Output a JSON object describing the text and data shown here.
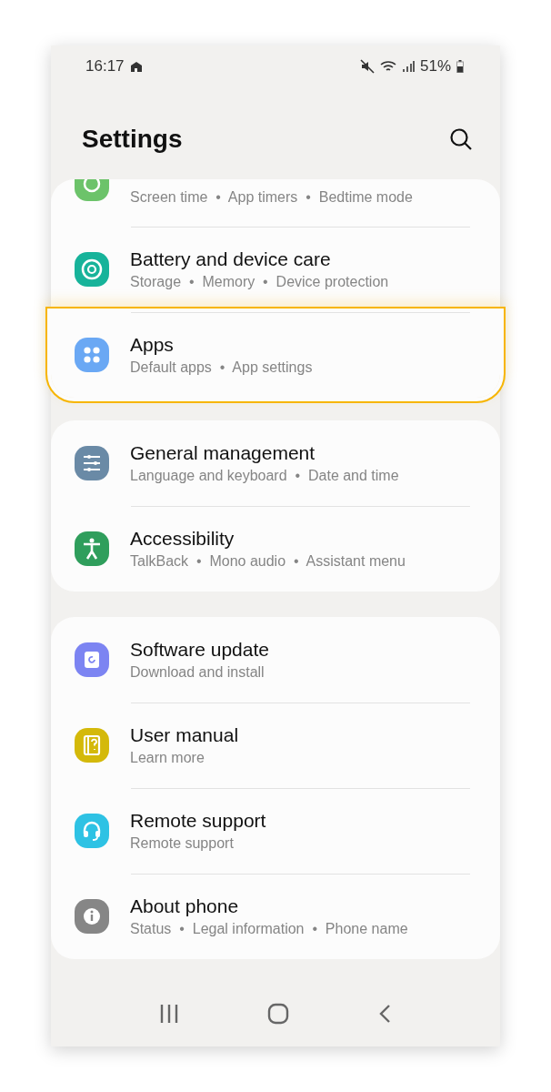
{
  "status_bar": {
    "time": "16:17",
    "battery": "51%"
  },
  "header": {
    "title": "Settings"
  },
  "groups": [
    {
      "items": [
        {
          "subtitle": "Screen time  •  App timers  •  Bedtime mode",
          "color": "#6cc36a",
          "clipped": true,
          "highlighted": false
        },
        {
          "title": "Battery and device care",
          "subtitle": "Storage  •  Memory  •  Device protection",
          "color": "#17b39a",
          "clipped": false,
          "highlighted": false
        },
        {
          "title": "Apps",
          "subtitle": "Default apps  •  App settings",
          "color": "#6aa8f4",
          "clipped": false,
          "highlighted": true
        }
      ]
    },
    {
      "items": [
        {
          "title": "General management",
          "subtitle": "Language and keyboard  •  Date and time",
          "color": "#6a8aa6",
          "clipped": false,
          "highlighted": false
        },
        {
          "title": "Accessibility",
          "subtitle": "TalkBack  •  Mono audio  •  Assistant menu",
          "color": "#2f9e5c",
          "clipped": false,
          "highlighted": false
        }
      ]
    },
    {
      "items": [
        {
          "title": "Software update",
          "subtitle": "Download and install",
          "color": "#7c84f2",
          "clipped": false,
          "highlighted": false
        },
        {
          "title": "User manual",
          "subtitle": "Learn more",
          "color": "#d4b90a",
          "clipped": false,
          "highlighted": false
        },
        {
          "title": "Remote support",
          "subtitle": "Remote support",
          "color": "#2ec2e4",
          "clipped": false,
          "highlighted": false
        },
        {
          "title": "About phone",
          "subtitle": "Status  •  Legal information  •  Phone name",
          "color": "#868686",
          "clipped": false,
          "highlighted": false
        }
      ]
    }
  ]
}
